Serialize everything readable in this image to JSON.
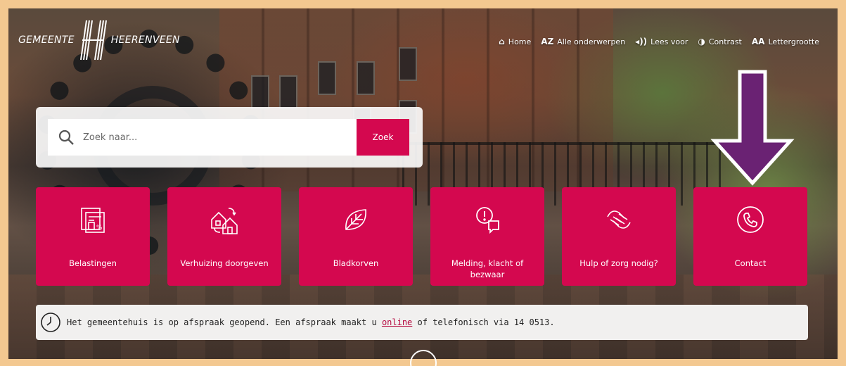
{
  "logo": {
    "left_text": "GEMEENTE",
    "right_text": "HEERENVEEN"
  },
  "topnav": [
    {
      "icon": "home-icon",
      "glyph": "⌂",
      "label": "Home"
    },
    {
      "icon": "az-icon",
      "glyph": "AZ",
      "label": "Alle onderwerpen"
    },
    {
      "icon": "speaker-icon",
      "glyph": "◂))",
      "label": "Lees voor"
    },
    {
      "icon": "contrast-icon",
      "glyph": "◑",
      "label": "Contrast"
    },
    {
      "icon": "text-size-icon",
      "glyph": "AA",
      "label": "Lettergrootte"
    }
  ],
  "search": {
    "placeholder": "Zoek naar...",
    "button_label": "Zoek"
  },
  "tiles": [
    {
      "label": "Belastingen",
      "icon": "tax-document-icon"
    },
    {
      "label": "Verhuizing doorgeven",
      "icon": "moving-house-icon"
    },
    {
      "label": "Bladkorven",
      "icon": "leaf-icon"
    },
    {
      "label": "Melding, klacht of bezwaar",
      "icon": "complaint-chat-icon"
    },
    {
      "label": "Hulp of zorg nodig?",
      "icon": "helping-hand-icon"
    },
    {
      "label": "Contact",
      "icon": "phone-icon"
    }
  ],
  "notice": {
    "text_before": "Het gemeentehuis is op afspraak geopend. Een afspraak maakt u ",
    "link_text": "online",
    "text_after": " of telefonisch via 14 0513."
  },
  "colors": {
    "accent": "#d4084f",
    "arrow": "#6a2273",
    "frame": "#f3c890"
  }
}
